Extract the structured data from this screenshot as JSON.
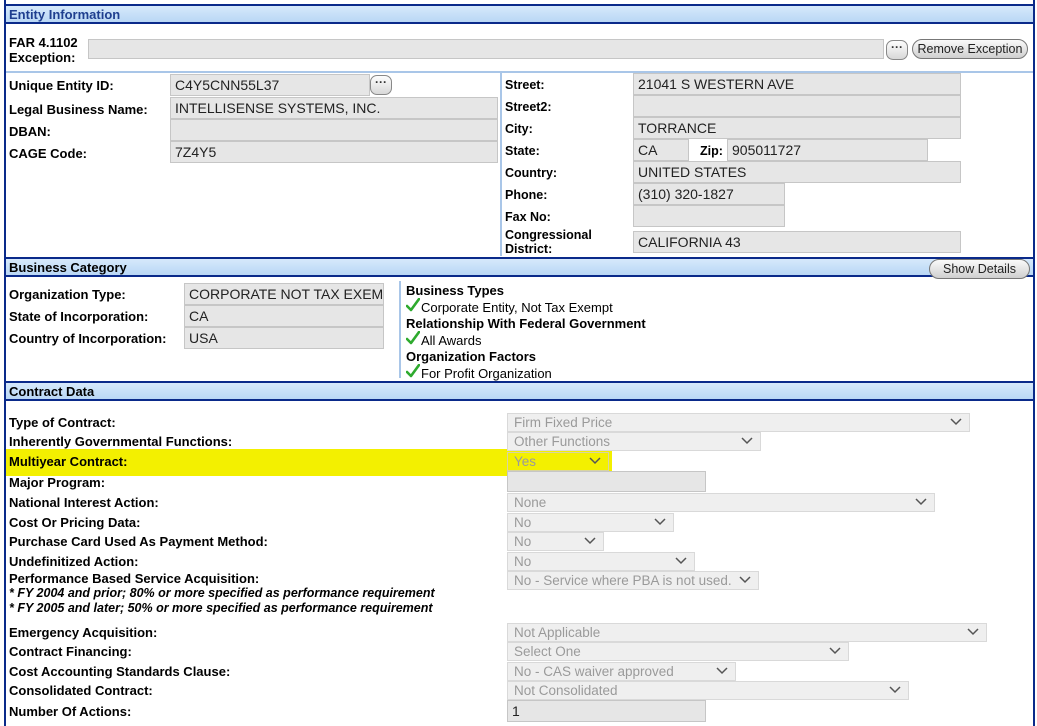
{
  "entity": {
    "header": "Entity Information",
    "far_label_1": "FAR 4.1102",
    "far_label_2": "Exception:",
    "far_value": "",
    "remove_exception_label": "Remove Exception",
    "left": [
      {
        "label": "Unique Entity ID:",
        "value": "C4Y5CNN55L37"
      },
      {
        "label": "Legal Business Name:",
        "value": "INTELLISENSE SYSTEMS, INC."
      },
      {
        "label": "DBAN:",
        "value": ""
      },
      {
        "label": "CAGE Code:",
        "value": "7Z4Y5"
      }
    ],
    "street_label": "Street:",
    "street": "21041 S WESTERN AVE",
    "street2_label": "Street2:",
    "street2": "",
    "city_label": "City:",
    "city": "TORRANCE",
    "state_label": "State:",
    "state": "CA",
    "zip_label": "Zip:",
    "zip": "905011727",
    "country_label": "Country:",
    "country": "UNITED STATES",
    "phone_label": "Phone:",
    "phone": "(310) 320-1827",
    "fax_label": "Fax No:",
    "fax": "",
    "district_label_1": "Congressional",
    "district_label_2": "District:",
    "district": "CALIFORNIA 43"
  },
  "business": {
    "header": "Business Category",
    "show_details_label": "Show Details",
    "org_type_label": "Organization Type:",
    "org_type": "CORPORATE NOT TAX EXEMPT",
    "state_inc_label": "State of Incorporation:",
    "state_inc": "CA",
    "country_inc_label": "Country of Incorporation:",
    "country_inc": "USA",
    "types_heading": "Business Types",
    "types_item": "Corporate Entity, Not Tax Exempt",
    "relationship_heading": "Relationship With Federal Government",
    "relationship_item": "All Awards",
    "factors_heading": "Organization Factors",
    "factors_item": "For Profit Organization",
    "check_color": "#2eaa2e"
  },
  "contract": {
    "header": "Contract Data",
    "highlight_color": "#f3f000",
    "rows": [
      {
        "label": "Type of Contract:",
        "value": "Firm Fixed Price"
      },
      {
        "label": "Inherently Governmental Functions:",
        "value": "Other Functions"
      },
      {
        "label": "Multiyear Contract:",
        "value": "Yes"
      },
      {
        "label": "Major Program:",
        "value": ""
      },
      {
        "label": "National Interest Action:",
        "value": "None"
      },
      {
        "label": "Cost Or Pricing Data:",
        "value": "No"
      },
      {
        "label": "Purchase Card Used As Payment Method:",
        "value": "No"
      },
      {
        "label": "Undefinitized Action:",
        "value": "No"
      },
      {
        "label": "Performance Based Service Acquisition:",
        "value": "No - Service where PBA is not used."
      },
      {
        "label": "Emergency Acquisition:",
        "value": "Not Applicable"
      },
      {
        "label": "Contract Financing:",
        "value": "Select One"
      },
      {
        "label": "Cost Accounting Standards Clause:",
        "value": "No - CAS waiver approved"
      },
      {
        "label": "Consolidated Contract:",
        "value": "Not Consolidated"
      },
      {
        "label": "Number Of Actions:",
        "value": "1"
      }
    ],
    "pba_note_1": "* FY 2004 and prior; 80% or more specified as performance requirement",
    "pba_note_2": "* FY 2005 and later; 50% or more specified as performance requirement"
  }
}
